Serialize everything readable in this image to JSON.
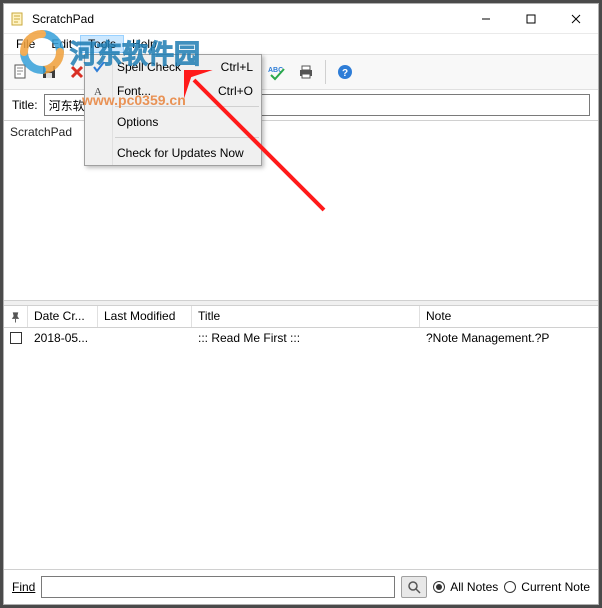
{
  "window": {
    "title": "ScratchPad",
    "buttons": {
      "min": "—",
      "max": "☐",
      "close": "✕"
    }
  },
  "menubar": {
    "file": "File",
    "edit": "Edit",
    "tools": "Tools",
    "help": "Help"
  },
  "tools_menu": {
    "spell_check": "Spell Check",
    "spell_check_shortcut": "Ctrl+L",
    "font": "Font...",
    "font_shortcut": "Ctrl+O",
    "options": "Options",
    "updates": "Check for Updates Now"
  },
  "title_row": {
    "label": "Title:",
    "value": "河东软"
  },
  "editor": {
    "text": "ScratchPad"
  },
  "grid": {
    "headers": {
      "pin": "📌",
      "date": "Date Cr...",
      "modified": "Last Modified",
      "title": "Title",
      "note": "Note"
    },
    "rows": [
      {
        "date": "2018-05...",
        "modified": "",
        "title": "::: Read Me First :::",
        "note": "?Note Management.?P"
      }
    ]
  },
  "find": {
    "label": "Find",
    "all_notes": "All Notes",
    "current_note": "Current Note"
  },
  "watermark": {
    "text": "河东软件园",
    "url": "www.pc0359.cn"
  }
}
